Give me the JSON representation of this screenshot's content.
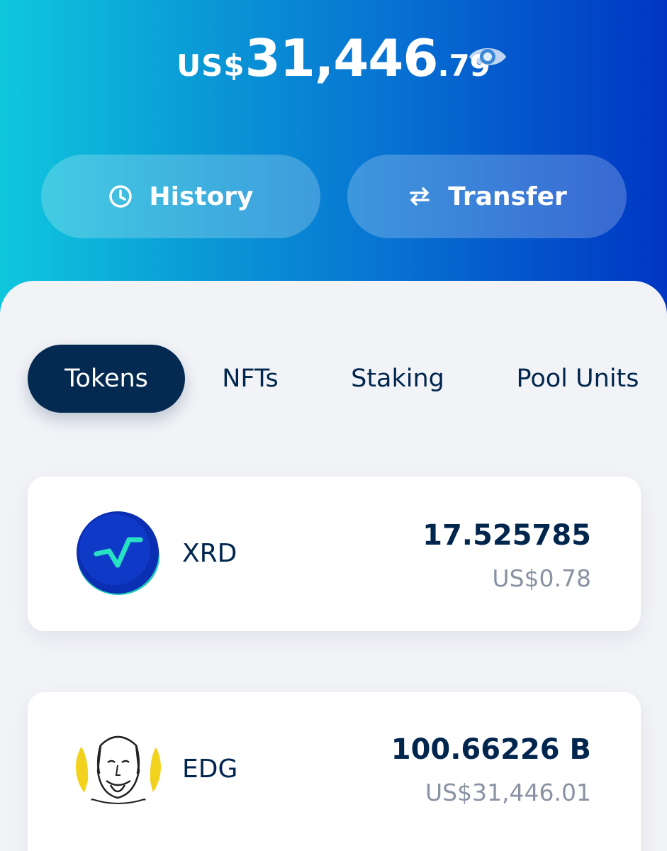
{
  "balance": {
    "currency": "US$",
    "whole": "31,446",
    "cents": ".79",
    "toggle_icon": "eye-icon"
  },
  "actions": {
    "history": {
      "label": "History",
      "icon": "clock-icon"
    },
    "transfer": {
      "label": "Transfer",
      "icon": "transfer-arrows-icon"
    }
  },
  "tabs": [
    {
      "label": "Tokens",
      "active": true
    },
    {
      "label": "NFTs",
      "active": false
    },
    {
      "label": "Staking",
      "active": false
    },
    {
      "label": "Pool Units",
      "active": false
    }
  ],
  "tokens": [
    {
      "symbol": "XRD",
      "amount": "17.525785",
      "value": "US$0.78",
      "icon": "xrd-logo-icon"
    },
    {
      "symbol": "EDG",
      "amount": "100.66226 B",
      "value": "US$31,446.01",
      "icon": "edg-portrait-icon"
    }
  ],
  "colors": {
    "header_gradient_start": "#0fc7dd",
    "header_gradient_end": "#0036c4",
    "navy": "#052a52",
    "text_dark": "#00264d",
    "text_muted": "#8a93a3",
    "panel_bg": "#f2f3f7"
  }
}
